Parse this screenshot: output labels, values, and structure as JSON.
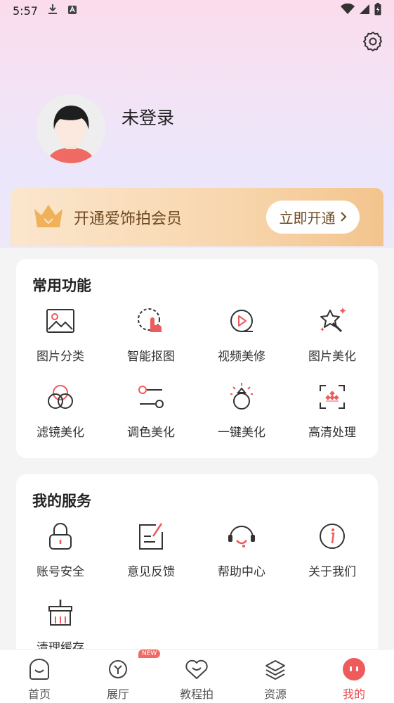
{
  "status_bar": {
    "time": "5:57"
  },
  "profile": {
    "username": "未登录"
  },
  "vip": {
    "title": "开通爱饰拍会员",
    "button": "立即开通"
  },
  "common_features": {
    "title": "常用功能",
    "items": [
      {
        "label": "图片分类",
        "icon": "image-icon"
      },
      {
        "label": "智能抠图",
        "icon": "cutout-icon"
      },
      {
        "label": "视频美修",
        "icon": "video-play-icon"
      },
      {
        "label": "图片美化",
        "icon": "sparkle-star-icon"
      },
      {
        "label": "滤镜美化",
        "icon": "filter-circles-icon"
      },
      {
        "label": "调色美化",
        "icon": "sliders-icon"
      },
      {
        "label": "一键美化",
        "icon": "ring-icon"
      },
      {
        "label": "高清处理",
        "icon": "hd-scan-icon"
      }
    ]
  },
  "my_services": {
    "title": "我的服务",
    "items": [
      {
        "label": "账号安全",
        "icon": "lock-icon"
      },
      {
        "label": "意见反馈",
        "icon": "feedback-icon"
      },
      {
        "label": "帮助中心",
        "icon": "headset-icon"
      },
      {
        "label": "关于我们",
        "icon": "info-icon"
      },
      {
        "label": "清理缓存",
        "icon": "broom-icon"
      }
    ]
  },
  "tabbar": {
    "items": [
      {
        "label": "首页",
        "icon": "home-icon"
      },
      {
        "label": "展厅",
        "icon": "gallery-icon"
      },
      {
        "label": "教程拍",
        "icon": "heart-icon"
      },
      {
        "label": "资源",
        "icon": "layers-icon"
      },
      {
        "label": "我的",
        "icon": "profile-face-icon"
      }
    ],
    "badge": "NEW"
  },
  "colors": {
    "accent": "#e8484a",
    "vip_text": "#6e4a23",
    "icon_red": "#ee5b5c"
  }
}
